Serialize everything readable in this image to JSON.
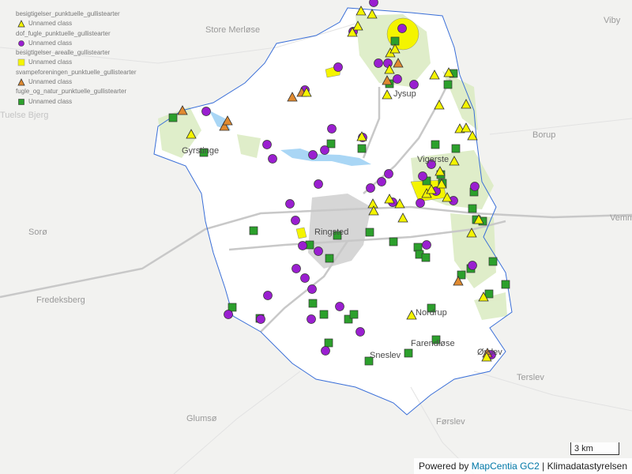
{
  "places_outside": [
    {
      "id": "store-merlose",
      "label": "Store Merløse"
    },
    {
      "id": "vibyl",
      "label": "Viby"
    },
    {
      "id": "borup",
      "label": "Borup"
    },
    {
      "id": "vemm",
      "label": "Vemm"
    },
    {
      "id": "soro",
      "label": "Sorø"
    },
    {
      "id": "fredeksberg",
      "label": "Fredeksberg"
    },
    {
      "id": "glumso",
      "label": "Glumsø"
    },
    {
      "id": "forslev",
      "label": "Førslev"
    },
    {
      "id": "terslev",
      "label": "Terslev"
    },
    {
      "id": "tuelse",
      "label": "Tuelse Bjerg"
    }
  ],
  "places_inside": [
    {
      "id": "jysup",
      "label": "Jysup"
    },
    {
      "id": "gyrstinge",
      "label": "Gyrstinge"
    },
    {
      "id": "vigersted",
      "label": "Vigerste"
    },
    {
      "id": "ringsted",
      "label": "Ringsted"
    },
    {
      "id": "nordrup",
      "label": "Nordrup"
    },
    {
      "id": "farendlose",
      "label": "Farendløse"
    },
    {
      "id": "sneslev",
      "label": "Sneslev"
    },
    {
      "id": "orslev",
      "label": "Ørslev"
    }
  ],
  "legend": [
    {
      "layer": "besigtigelser_punktuelle_gullistearter",
      "cls": "Unnamed class",
      "symbol": "yellow-triangle"
    },
    {
      "layer": "dof_fugle_punktuelle_gullistearter",
      "cls": "Unnamed class",
      "symbol": "purple-circle"
    },
    {
      "layer": "besigtigelser_arealle_gullistearter",
      "cls": "Unnamed class",
      "symbol": "yellow-square"
    },
    {
      "layer": "svampeforeningen_punktuelle_gullistearter",
      "cls": "Unnamed class",
      "symbol": "orange-triangle"
    },
    {
      "layer": "fugle_og_natur_punktuelle_gullistearter",
      "cls": "Unnamed class",
      "symbol": "green-square"
    }
  ],
  "colors": {
    "yellow": "#f4f400",
    "purple": "#9a1fd0",
    "orange": "#e08a30",
    "green": "#2ca02c",
    "boundary": "#3a6fd8",
    "forest": "#dcecc4"
  },
  "scalebar": {
    "label": "3 km"
  },
  "attribution": {
    "prefix": "Powered by",
    "link": "MapCentia GC2",
    "suffix": "| Klimadatastyrelsen"
  }
}
